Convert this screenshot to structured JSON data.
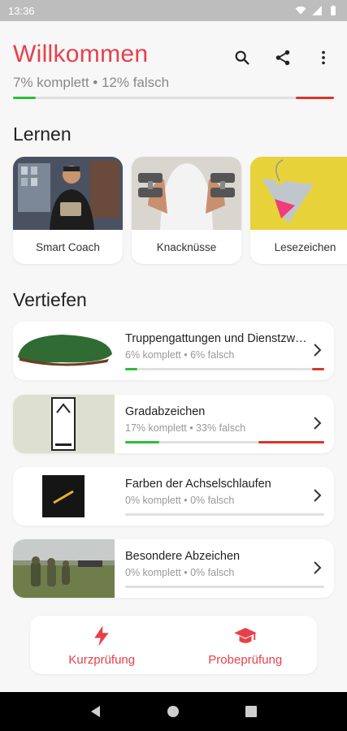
{
  "status_bar": {
    "time": "13:36",
    "icons": [
      "wifi-icon",
      "signal-icon",
      "battery-icon"
    ]
  },
  "header": {
    "title": "Willkommen",
    "subtitle": "7% komplett • 12% falsch",
    "progress_complete": 0.07,
    "progress_wrong": 0.12,
    "actions": [
      "search-icon",
      "share-icon",
      "more-vert-icon"
    ]
  },
  "learn": {
    "title": "Lernen",
    "cards": [
      {
        "label": "Smart Coach",
        "image": "coach-photo"
      },
      {
        "label": "Knacknüsse",
        "image": "dumbbell-photo"
      },
      {
        "label": "Lesezeichen",
        "image": "tag-illustration"
      }
    ]
  },
  "deepen": {
    "title": "Vertiefen",
    "items": [
      {
        "title": "Truppengattungen und Dienstzweige",
        "status": "6% komplett • 6% falsch",
        "complete": 0.06,
        "wrong": 0.06,
        "image": "beret-image"
      },
      {
        "title": "Gradabzeichen",
        "status": "17% komplett • 33% falsch",
        "complete": 0.17,
        "wrong": 0.33,
        "image": "rank-insignia-image"
      },
      {
        "title": "Farben der Achselschlaufen",
        "status": "0% komplett • 0% falsch",
        "complete": 0,
        "wrong": 0,
        "image": "shoulder-loop-image"
      },
      {
        "title": "Besondere Abzeichen",
        "status": "0% komplett • 0% falsch",
        "complete": 0,
        "wrong": 0,
        "image": "soldiers-photo"
      }
    ]
  },
  "bottom": {
    "quick_label": "Kurzprüfung",
    "trial_label": "Probeprüfung"
  },
  "colors": {
    "accent": "#e8404a",
    "complete": "#2bbf3a",
    "wrong": "#d9342b"
  }
}
